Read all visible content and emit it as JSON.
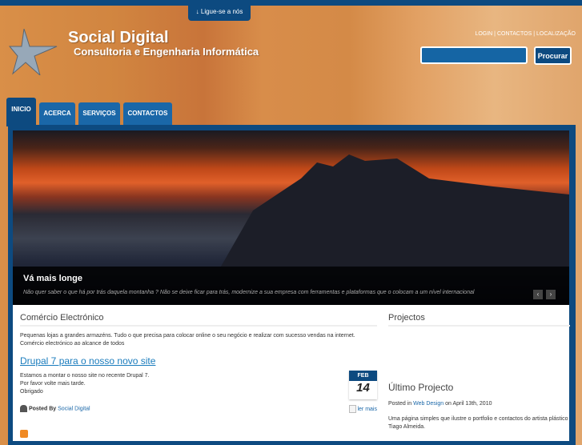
{
  "header": {
    "call_tab": "↓ Ligue-se a nós",
    "title": "Social Digital",
    "subtitle": "Consultoria e Engenharia Informática",
    "links": [
      "LOGIN",
      "CONTACTOS",
      "LOCALIZAÇÃO"
    ],
    "search_value": "",
    "search_button": "Procurar"
  },
  "nav": [
    {
      "label": "INICIO",
      "active": true
    },
    {
      "label": "ACERCA"
    },
    {
      "label": "SERVIÇOS"
    },
    {
      "label": "CONTACTOS"
    }
  ],
  "slider": {
    "title": "Vá mais longe",
    "text": "Não quer saber o que há por trás daquela montanha ? Não se deixe ficar para trás, modernize a sua empresa com ferramentas e plataformas que o colocam a um nível internacional",
    "prev": "‹",
    "next": "›"
  },
  "left": {
    "heading": "Comércio Electrónico",
    "intro": "Pequenas lojas a grandes armazéns. Tudo o que precisa para colocar online o seu negócio e realizar com sucesso vendas na internet. Comércio electrónico ao alcance de todos",
    "post": {
      "title": "Drupal 7 para o nosso novo site",
      "lines": [
        "Estamos a montar o nosso site no recente Drupal 7.",
        "Por favor volte mais tarde.",
        "Obrigado"
      ],
      "month": "FEB",
      "day": "14",
      "posted_by": "Posted By",
      "author": "Social Digital",
      "read_more": "ler mais"
    }
  },
  "right": {
    "heading": "Projectos",
    "sub_heading": "Último Projecto",
    "posted_in": "Posted in",
    "category": "Web Design",
    "date": "on April 13th, 2010",
    "text": "Uma página simples que ilustre o portfolio e contactos do artista plástico Tiago Almeida."
  }
}
